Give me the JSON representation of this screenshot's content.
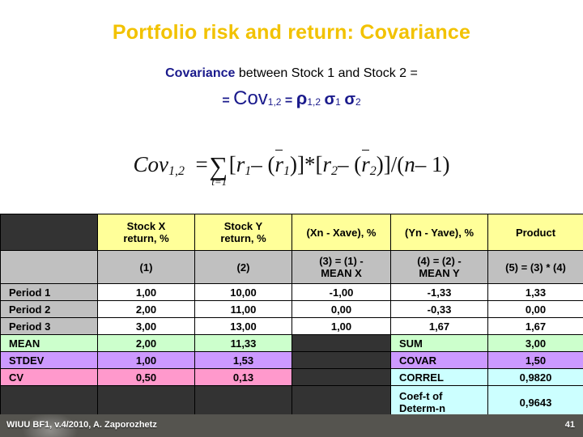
{
  "slide": {
    "title": "Portfolio risk and return: Covariance",
    "title_color": "#f2c200",
    "accent_color": "#1a1a8c"
  },
  "subtitle": {
    "keyword": "Covariance",
    "line1_rest": " between Stock 1 and Stock 2 =",
    "line2": {
      "equals1": "= ",
      "cov": "Cov",
      "cov_sub": "1,2",
      "equals2": " = ",
      "rho": "ρ",
      "rho_sub": "1,2",
      "sigma1": "σ",
      "sigma1_sub": "1",
      "sigma2": "σ",
      "sigma2_sub": "2"
    }
  },
  "equation": {
    "lhs": "Cov",
    "lhs_sub": "1,2",
    "equals": "=",
    "sigma": "∑",
    "sigma_limit": "t=1",
    "open_bracket": "[",
    "r1": "r",
    "r1_sub": "1",
    "minus1": "– (",
    "r1bar": "r",
    "r1bar_sub": "1",
    "close1": ")]",
    "times": "*",
    "open_bracket2": "[",
    "r2": "r",
    "r2_sub": "2",
    "minus2": "– (",
    "r2bar": "r",
    "r2bar_sub": "2",
    "close2": ")]",
    "divide": "/(",
    "n": "n",
    "minus_one": "– 1)"
  },
  "table": {
    "header": [
      "",
      "Stock X\nreturn, %",
      "Stock Y\nreturn, %",
      "(Xn - Xave), %",
      "(Yn - Yave), %",
      "Product"
    ],
    "header_cells": {
      "c0": "",
      "c1_l1": "Stock X",
      "c1_l2": "return, %",
      "c2_l1": "Stock Y",
      "c2_l2": "return, %",
      "c3": "(Xn - Xave), %",
      "c4": "(Yn - Yave), %",
      "c5": "Product"
    },
    "subheader_cells": {
      "c0": "",
      "c1": "(1)",
      "c2": "(2)",
      "c3_l1": "(3) = (1) -",
      "c3_l2": "MEAN X",
      "c4_l1": "(4) = (2) -",
      "c4_l2": "MEAN Y",
      "c5": "(5) = (3) * (4)"
    },
    "periods": [
      {
        "label": "Period 1",
        "x": "1,00",
        "y": "10,00",
        "dx": "-1,00",
        "dy": "-1,33",
        "product": "1,33"
      },
      {
        "label": "Period 2",
        "x": "2,00",
        "y": "11,00",
        "dx": "0,00",
        "dy": "-0,33",
        "product": "0,00"
      },
      {
        "label": "Period 3",
        "x": "3,00",
        "y": "13,00",
        "dx": "1,00",
        "dy": "1,67",
        "product": "1,67"
      }
    ],
    "mean": {
      "label": "MEAN",
      "x": "2,00",
      "y": "11,33",
      "stat_label": "SUM",
      "stat_value": "3,00"
    },
    "stdev": {
      "label": "STDEV",
      "x": "1,00",
      "y": "1,53",
      "stat_label": "COVAR",
      "stat_value": "1,50"
    },
    "cv": {
      "label": "CV",
      "x": "0,50",
      "y": "0,13",
      "stat_label": "CORREL",
      "stat_value": "0,9820"
    },
    "last": {
      "stat_label_l1": "Coef-t of",
      "stat_label_l2": "Determ-n",
      "stat_value": "0,9643"
    },
    "colors": {
      "header_bg": "#ffff99",
      "subheader_bg": "#c0c0c0",
      "period_label_bg": "#c0c0c0",
      "mean_bg": "#ccffcc",
      "stdev_bg": "#cc99ff",
      "cv_bg": "#ff99cc",
      "cyan_bg": "#ccffff",
      "dark_bg": "#333333"
    }
  },
  "footer": {
    "credit": "WIUU BF1, v.4/2010, A. Zaporozhetz",
    "page": "41"
  }
}
